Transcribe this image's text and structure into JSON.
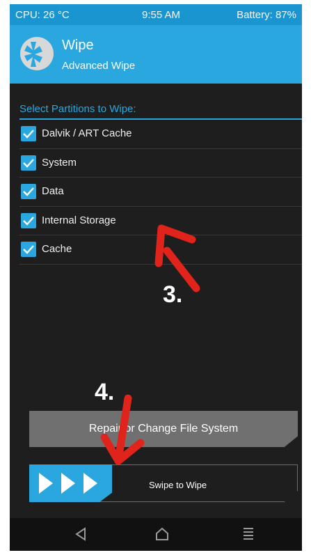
{
  "status_bar": {
    "cpu": "CPU: 26 °C",
    "time": "9:55 AM",
    "battery": "Battery: 87%"
  },
  "header": {
    "logo_icon": "twrp-logo-icon",
    "title": "Wipe",
    "subtitle": "Advanced Wipe"
  },
  "partitions": {
    "section_label": "Select Partitions to Wipe:",
    "items": [
      {
        "label": "Dalvik / ART Cache",
        "checked": true
      },
      {
        "label": "System",
        "checked": true
      },
      {
        "label": "Data",
        "checked": true
      },
      {
        "label": "Internal Storage",
        "checked": true
      },
      {
        "label": "Cache",
        "checked": true
      }
    ]
  },
  "annotations": {
    "step_3": "3.",
    "step_4": "4."
  },
  "actions": {
    "repair_label": "Repair or Change File System",
    "swipe_label": "Swipe to Wipe",
    "swipe_icon": "triple-chevron-right-icon"
  },
  "nav": {
    "back_icon": "back-triangle-icon",
    "home_icon": "home-icon",
    "menu_icon": "menu-lines-icon"
  },
  "colors": {
    "accent": "#2ba7df",
    "status_bar": "#1b95d0",
    "background": "#1e1e1e",
    "annotation_arrow": "#e0231b"
  }
}
